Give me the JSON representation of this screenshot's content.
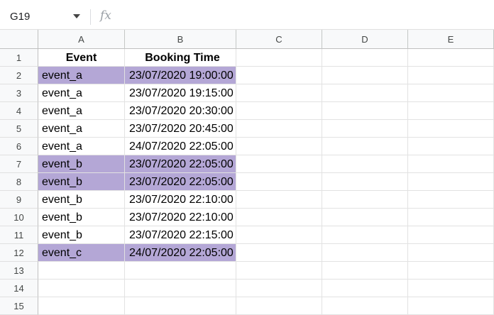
{
  "formula_bar": {
    "name_box": "G19",
    "fx_label": "fx",
    "formula": ""
  },
  "columns": [
    "A",
    "B",
    "C",
    "D",
    "E"
  ],
  "row_numbers": [
    "1",
    "2",
    "3",
    "4",
    "5",
    "6",
    "7",
    "8",
    "9",
    "10",
    "11",
    "12",
    "13",
    "14",
    "15"
  ],
  "header_row": {
    "a": "Event",
    "b": "Booking Time"
  },
  "rows": [
    {
      "a": "event_a",
      "b": "23/07/2020 19:00:00",
      "highlight": true
    },
    {
      "a": "event_a",
      "b": "23/07/2020 19:15:00",
      "highlight": false
    },
    {
      "a": "event_a",
      "b": "23/07/2020 20:30:00",
      "highlight": false
    },
    {
      "a": "event_a",
      "b": "23/07/2020 20:45:00",
      "highlight": false
    },
    {
      "a": "event_a",
      "b": "24/07/2020 22:05:00",
      "highlight": false
    },
    {
      "a": "event_b",
      "b": "23/07/2020 22:05:00",
      "highlight": true
    },
    {
      "a": "event_b",
      "b": "23/07/2020 22:05:00",
      "highlight": true
    },
    {
      "a": "event_b",
      "b": "23/07/2020 22:10:00",
      "highlight": false
    },
    {
      "a": "event_b",
      "b": "23/07/2020 22:10:00",
      "highlight": false
    },
    {
      "a": "event_b",
      "b": "23/07/2020 22:15:00",
      "highlight": false
    },
    {
      "a": "event_c",
      "b": "24/07/2020 22:05:00",
      "highlight": true
    }
  ],
  "colors": {
    "highlight": "#b4a7d6"
  },
  "icons": {
    "dropdown": "chevron-down-icon",
    "fx": "fx-icon"
  }
}
